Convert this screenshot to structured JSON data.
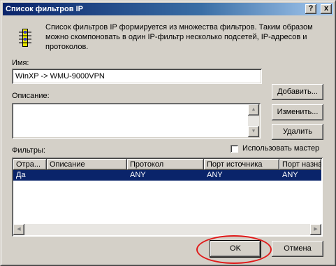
{
  "window": {
    "title": "Список фильтров IP",
    "help_btn": "?",
    "close_btn": "x"
  },
  "intro_text": "Список фильтров IP формируется из множества фильтров. Таким образом можно скомпоновать в один IP-фильтр несколько подсетей, IP-адресов и протоколов.",
  "name": {
    "label": "Имя:",
    "value": "WinXP -> WMU-9000VPN"
  },
  "description": {
    "label": "Описание:",
    "value": ""
  },
  "buttons": {
    "add": "Добавить...",
    "edit": "Изменить...",
    "delete": "Удалить",
    "ok": "OK",
    "cancel": "Отмена"
  },
  "filters": {
    "label": "Фильтры:",
    "wizard_checkbox_label": "Использовать мастер",
    "wizard_checked": false,
    "columns": [
      "Отра...",
      "Описание",
      "Протокол",
      "Порт источника",
      "Порт назна"
    ],
    "rows": [
      [
        "Да",
        "",
        "ANY",
        "ANY",
        "ANY"
      ]
    ]
  },
  "colors": {
    "titlebar_start": "#0a246a",
    "selection": "#0a246a",
    "highlight_oval": "#e01a1a"
  }
}
